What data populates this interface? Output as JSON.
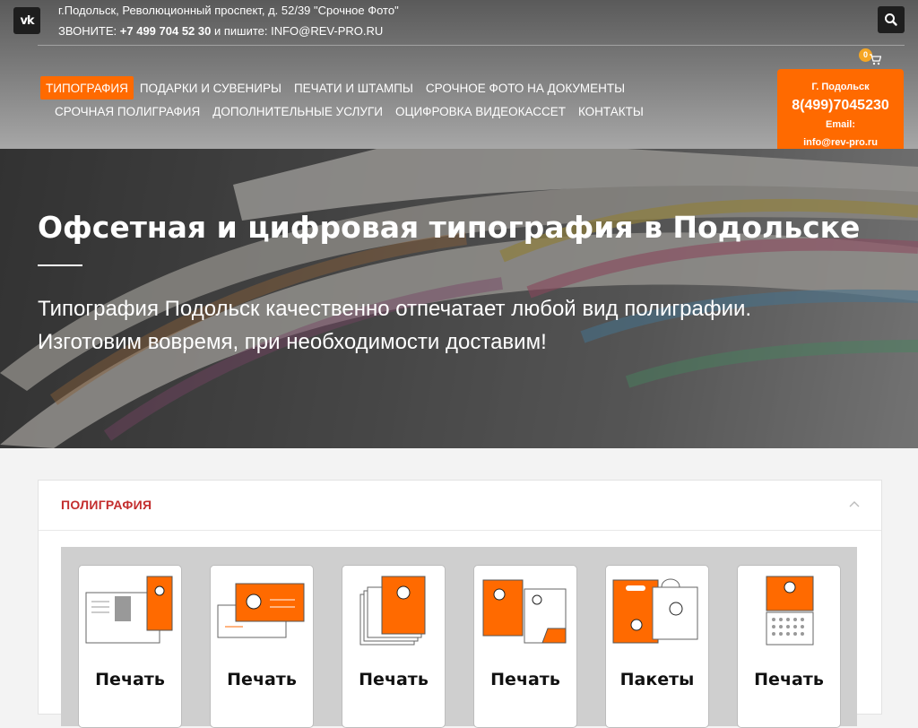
{
  "header": {
    "vk_label": "vk",
    "address": "г.Подольск, Революционный проспект, д. 52/39 \"Срочное Фото\"",
    "call_prefix": "ЗВОНИТЕ: ",
    "phone": "+7 499 704 52 30",
    "write_prefix": " и пишите: ",
    "email": "INFO@REV-PRO.RU",
    "cart_count": "0"
  },
  "nav": {
    "row1": [
      "ТИПОГРАФИЯ",
      "ПОДАРКИ И СУВЕНИРЫ",
      "ПЕЧАТИ И ШТАМПЫ",
      "СРОЧНОЕ ФОТО НА ДОКУМЕНТЫ"
    ],
    "row2": [
      "СРОЧНАЯ ПОЛИГРАФИЯ",
      "ДОПОЛНИТЕЛЬНЫЕ УСЛУГИ",
      "ОЦИФРОВКА ВИДЕОКАССЕТ",
      "КОНТАКТЫ"
    ]
  },
  "callbox": {
    "city": "Г. Подольск",
    "phone": "8(499)7045230",
    "email_label": "Email:",
    "email": "info@rev-pro.ru"
  },
  "hero": {
    "title": "Офсетная и цифровая типография в Подольске",
    "subtitle_line1": "Типография Подольск качественно отпечатает любой вид полиграфии.",
    "subtitle_line2": "Изготовим вовремя, при необходимости доставим!"
  },
  "section": {
    "title": "ПОЛИГРАФИЯ",
    "cards": [
      "Печать",
      "Печать",
      "Печать",
      "Печать",
      "Пакеты",
      "Печать"
    ]
  },
  "colors": {
    "accent": "#ff6a00",
    "section_title": "#c32d2d"
  },
  "icons": [
    "vk-icon",
    "search-icon",
    "cart-icon",
    "chevron-up-icon"
  ]
}
